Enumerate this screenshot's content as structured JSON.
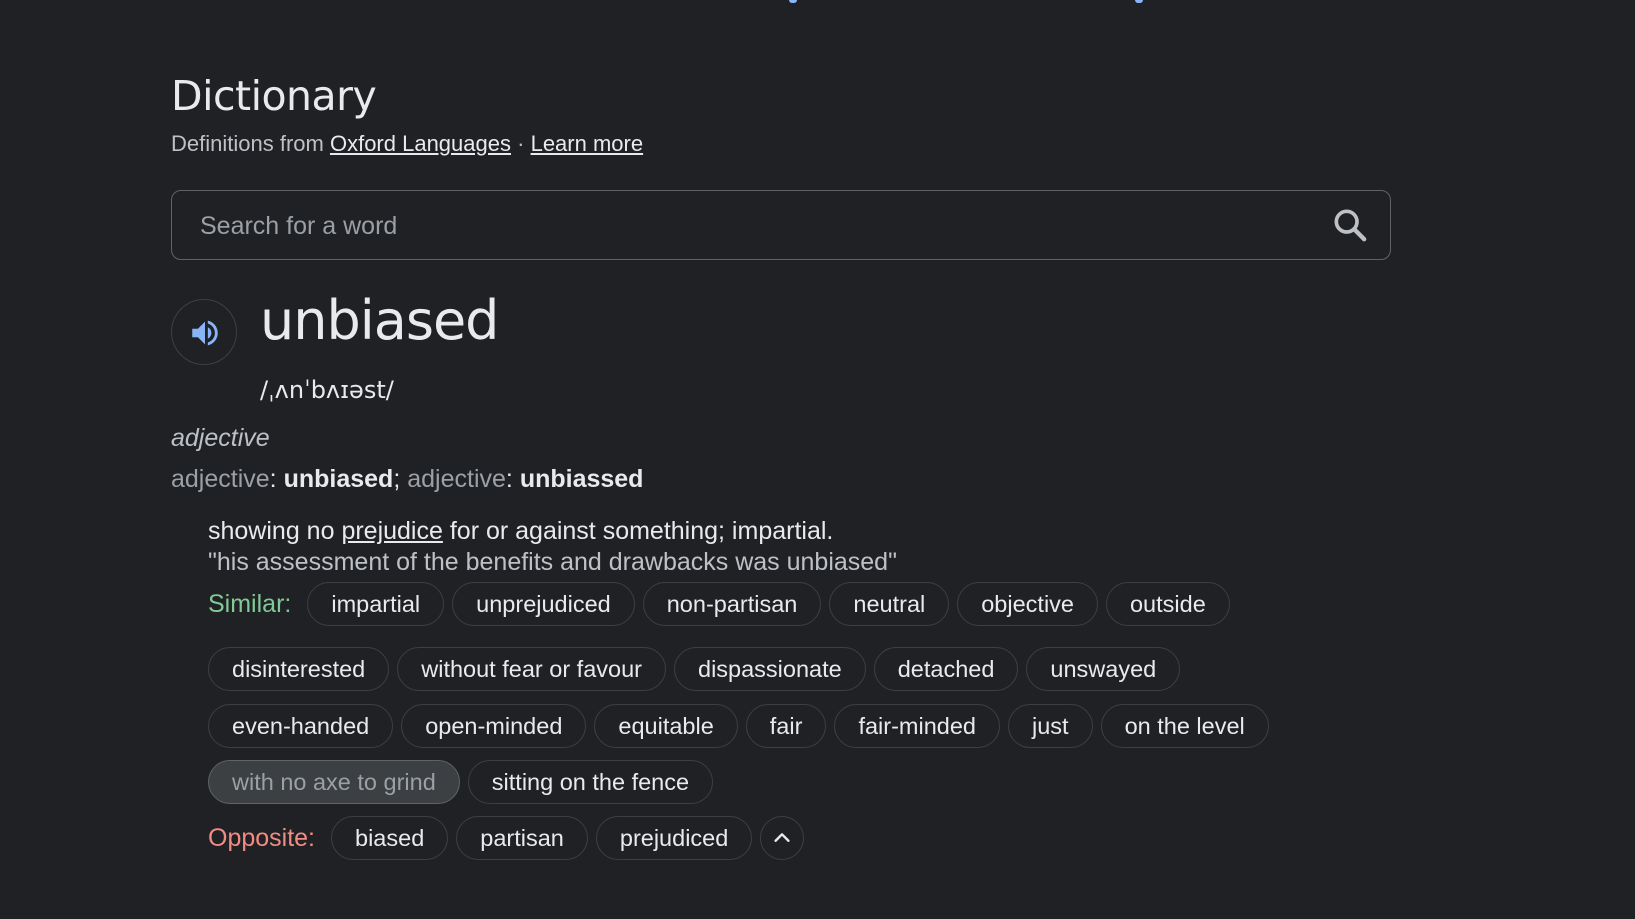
{
  "dictionary": {
    "title": "Dictionary",
    "source_prefix": "Definitions from",
    "source_link": "Oxford Languages",
    "separator": "·",
    "learn_more": "Learn more"
  },
  "search": {
    "placeholder": "Search for a word",
    "icon": "search-icon"
  },
  "entry": {
    "audio_icon": "speaker-icon",
    "word": "unbiased",
    "phonetic": "/ˌʌnˈbʌɪəst/",
    "part_of_speech": "adjective",
    "forms_label_1": "adjective",
    "form_1": "unbiased",
    "forms_label_2": "adjective",
    "form_2": "unbiassed",
    "definition_before": "showing no",
    "definition_link": "prejudice",
    "definition_after": "for or against something; impartial.",
    "example": "\"his assessment of the benefits and drawbacks was unbiased\""
  },
  "similar": {
    "label": "Similar:",
    "label_color": "#81c995",
    "rows": [
      [
        "impartial",
        "unprejudiced",
        "non-partisan",
        "neutral",
        "objective",
        "outside"
      ],
      [
        "disinterested",
        "without fear or favour",
        "dispassionate",
        "detached",
        "unswayed"
      ],
      [
        "even-handed",
        "open-minded",
        "equitable",
        "fair",
        "fair-minded",
        "just",
        "on the level"
      ],
      [
        "with no axe to grind",
        "sitting on the fence"
      ]
    ]
  },
  "opposite": {
    "label": "Opposite:",
    "label_color": "#f28b82",
    "words": [
      "biased",
      "partisan",
      "prejudiced"
    ],
    "collapse_icon": "chevron-up-icon"
  }
}
